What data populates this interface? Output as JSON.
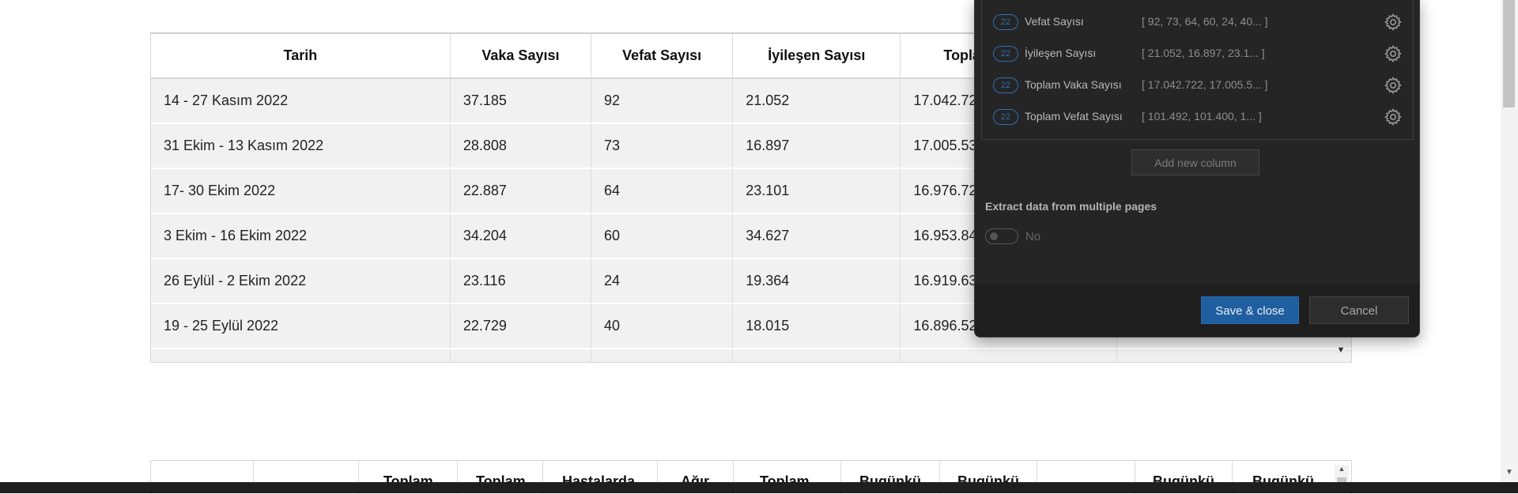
{
  "main_table": {
    "headers": [
      "Tarih",
      "Vaka Sayısı",
      "Vefat Sayısı",
      "İyileşen Sayısı",
      "Topla",
      ""
    ],
    "rows": [
      [
        "14 - 27 Kasım 2022",
        "37.185",
        "92",
        "21.052",
        "17.042.72",
        ""
      ],
      [
        "31 Ekim - 13 Kasım 2022",
        "28.808",
        "73",
        "16.897",
        "17.005.53",
        ""
      ],
      [
        "17- 30 Ekim 2022",
        "22.887",
        "64",
        "23.101",
        "16.976.72",
        ""
      ],
      [
        "3 Ekim - 16 Ekim 2022",
        "34.204",
        "60",
        "34.627",
        "16.953.84",
        ""
      ],
      [
        "26 Eylül - 2 Ekim 2022",
        "23.116",
        "24",
        "19.364",
        "16.919.63",
        ""
      ],
      [
        "19 - 25 Eylül 2022",
        "22.729",
        "40",
        "18.015",
        "16.896.52",
        ""
      ]
    ]
  },
  "second_table": {
    "headers": [
      "",
      "",
      "Toplam",
      "Toplam",
      "Hastalarda",
      "Ağır",
      "Toplam",
      "Bugünkü",
      "Bugünkü",
      "",
      "Bugünkü",
      "Bugünkü"
    ]
  },
  "dialog": {
    "columns": [
      {
        "badge": "22",
        "name": "Vefat Sayısı",
        "values": "[ 92, 73, 64, 60, 24, 40... ]"
      },
      {
        "badge": "22",
        "name": "İyileşen Sayısı",
        "values": "[ 21.052, 16.897, 23.1... ]"
      },
      {
        "badge": "22",
        "name": "Toplam Vaka Sayısı",
        "values": "[ 17.042.722, 17.005.5... ]"
      },
      {
        "badge": "22",
        "name": "Toplam Vefat Sayısı",
        "values": "[ 101.492, 101.400, 1... ]"
      }
    ],
    "add_column_label": "Add new column",
    "extract_label": "Extract data from multiple pages",
    "toggle_value": "No",
    "save_label": "Save & close",
    "cancel_label": "Cancel"
  },
  "icons": {
    "column_settings": "gear-icon",
    "table_scroll": "triangle-down-icon"
  },
  "colors": {
    "accent": "#1f5e9f",
    "badge": "#2f6fb3",
    "dialog_bg": "#252526"
  }
}
